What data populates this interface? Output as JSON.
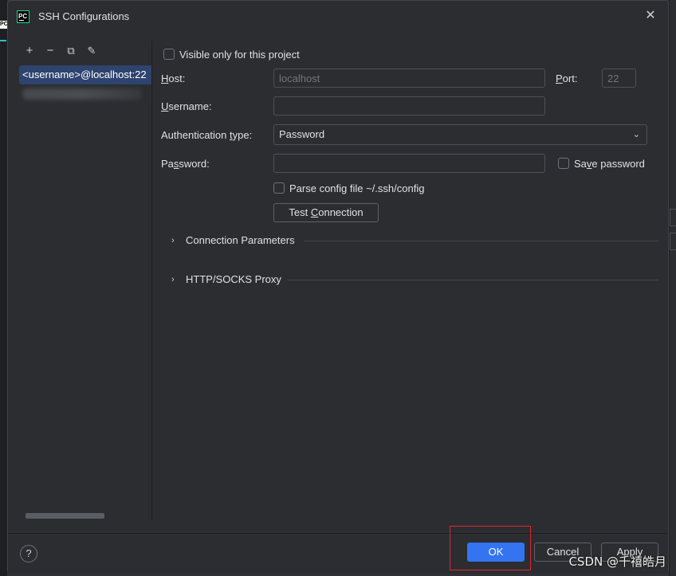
{
  "window": {
    "title": "SSH Configurations",
    "logo_text": "PC"
  },
  "toolbar": {
    "add": "+",
    "remove": "−",
    "copy": "⧉",
    "edit": "✎"
  },
  "list": {
    "selected_item": "<username>@localhost:22"
  },
  "form": {
    "visible_only_label": "Visible only for this project",
    "host_label_pre": "",
    "host_label_u": "H",
    "host_label_post": "ost:",
    "host_placeholder": "localhost",
    "port_label_pre": "",
    "port_label_u": "P",
    "port_label_post": "ort:",
    "port_placeholder": "22",
    "username_label_pre": "",
    "username_label_u": "U",
    "username_label_post": "sername:",
    "auth_label_pre": "Authentication ",
    "auth_label_u": "t",
    "auth_label_post": "ype:",
    "auth_value": "Password",
    "password_label_pre": "Pa",
    "password_label_u": "s",
    "password_label_post": "sword:",
    "save_password_pre": "Sa",
    "save_password_u": "v",
    "save_password_post": "e password",
    "parse_config_label": "Parse config file ~/.ssh/config",
    "test_conn_pre": "Test ",
    "test_conn_u": "C",
    "test_conn_post": "onnection",
    "section_conn_params": "Connection Parameters",
    "section_proxy": "HTTP/SOCKS Proxy"
  },
  "footer": {
    "help": "?",
    "ok": "OK",
    "cancel": "Cancel",
    "apply": "Apply"
  },
  "watermark": "CSDN @千禧皓月",
  "colors": {
    "accent": "#3574f0",
    "selection": "#2e436e",
    "highlight_box": "#e0262f"
  }
}
